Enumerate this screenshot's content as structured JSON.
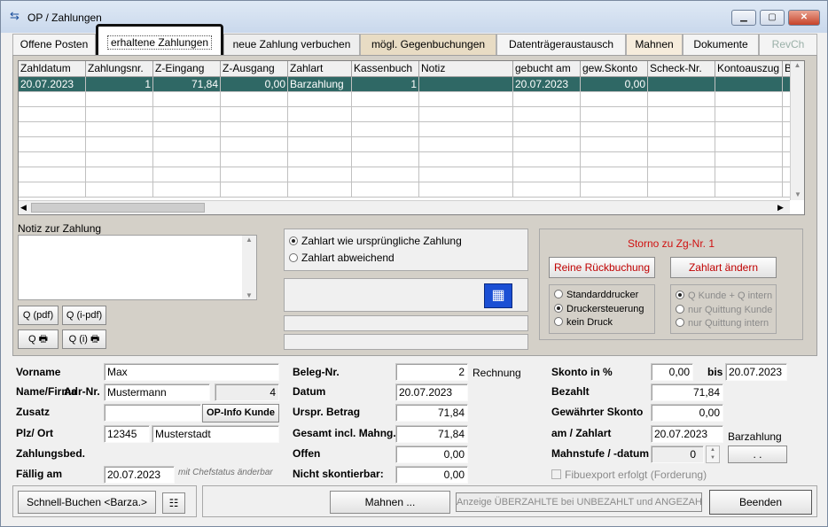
{
  "window": {
    "title": "OP / Zahlungen"
  },
  "tabs": [
    {
      "label": "Offene Posten"
    },
    {
      "label": "erhaltene Zahlungen"
    },
    {
      "label": "neue Zahlung verbuchen"
    },
    {
      "label": "mögl. Gegenbuchungen"
    },
    {
      "label": "Datenträgeraustausch"
    },
    {
      "label": "Mahnen"
    },
    {
      "label": "Dokumente"
    },
    {
      "label": "RevCh"
    }
  ],
  "grid": {
    "columns": [
      "Zahldatum",
      "Zahlungsnr.",
      "Z-Eingang",
      "Z-Ausgang",
      "Zahlart",
      "Kassenbuch",
      "Notiz",
      "gebucht am",
      "gew.Skonto",
      "Scheck-Nr.",
      "Kontoauszug",
      "B"
    ],
    "rows": [
      [
        "20.07.2023",
        "1",
        "71,84",
        "0,00",
        "Barzahlung",
        "1",
        "",
        "20.07.2023",
        "0,00",
        "",
        "",
        ""
      ]
    ]
  },
  "notiz": {
    "label": "Notiz zur Zahlung",
    "value": ""
  },
  "print_buttons": {
    "q_pdf": "Q (pdf)",
    "qi_pdf": "Q (i-pdf)",
    "q_print": "Q",
    "qi_print": "Q (i)"
  },
  "zahlart": {
    "option1": "Zahlart wie ursprüngliche Zahlung",
    "option2": "Zahlart abweichend",
    "selected": "option1"
  },
  "storno": {
    "title": "Storno zu Zg-Nr. 1",
    "reine_rueckbuchung": "Reine Rückbuchung",
    "zahlart_aendern": "Zahlart ändern",
    "printer_options": [
      "Standarddrucker",
      "Druckersteuerung",
      "kein Druck"
    ],
    "printer_selected": "Druckersteuerung",
    "quittung_options": [
      "Q Kunde + Q intern",
      "nur Quittung Kunde",
      "nur Quittung intern"
    ],
    "title_color": "#d01010"
  },
  "customer": {
    "vorname_label": "Vorname",
    "vorname": "Max",
    "name_label": "Name/Firma",
    "adr_label": "Adr-Nr.",
    "name": "Mustermann",
    "adr_nr": "4",
    "zusatz_label": "Zusatz",
    "zusatz": "",
    "op_info_button": "OP-Info Kunde",
    "plz_label": "Plz/ Ort",
    "plz": "12345",
    "ort": "Musterstadt",
    "zahlungsbed_label": "Zahlungsbed.",
    "faellig_label": "Fällig am",
    "faellig": "20.07.2023",
    "faellig_hint": "mit Chefstatus änderbar"
  },
  "beleg": {
    "beleg_nr_label": "Beleg-Nr.",
    "beleg_nr": "2",
    "beleg_typ": "Rechnung",
    "datum_label": "Datum",
    "datum": "20.07.2023",
    "urspr_label": "Urspr. Betrag",
    "urspr": "71,84",
    "gesamt_label": "Gesamt incl. Mahng.",
    "gesamt": "71,84",
    "offen_label": "Offen",
    "offen": "0,00",
    "nicht_skonto_label": "Nicht skontierbar:",
    "nicht_skonto": "0,00"
  },
  "skonto": {
    "skonto_label": "Skonto in %",
    "skonto": "0,00",
    "bis_label": "bis",
    "bis": "20.07.2023",
    "bezahlt_label": "Bezahlt",
    "bezahlt": "71,84",
    "gew_skonto_label": "Gewährter Skonto",
    "gew_skonto": "0,00",
    "am_zahlart_label": "am / Zahlart",
    "am": "20.07.2023",
    "zahlart": "Barzahlung",
    "mahnstufe_label": "Mahnstufe / -datum",
    "mahnstufe": "0",
    "mahndatum": ". .",
    "fibu_label": "Fibuexport erfolgt (Forderung)"
  },
  "bottom": {
    "schnell_buchen": "Schnell-Buchen <Barza.>",
    "mahnen": "Mahnen ...",
    "anzeige": "Anzeige ÜBERZAHLTE bei UNBEZAHLT und ANGEZAHLT",
    "beenden": "Beenden"
  }
}
